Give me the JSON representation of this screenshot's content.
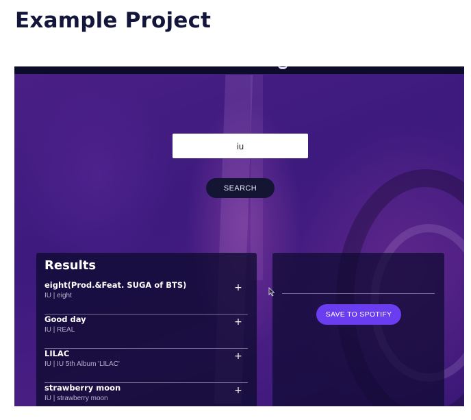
{
  "page": {
    "heading": "Example Project"
  },
  "app": {
    "search": {
      "value": "iu",
      "button_label": "SEARCH"
    },
    "results": {
      "title": "Results",
      "tracks": [
        {
          "name": "eight(Prod.&Feat. SUGA of BTS)",
          "meta": "IU | eight",
          "action": "+"
        },
        {
          "name": "Good day",
          "meta": "IU | REAL",
          "action": "+"
        },
        {
          "name": "LILAC",
          "meta": "IU | IU 5th Album 'LILAC'",
          "action": "+"
        },
        {
          "name": "strawberry moon",
          "meta": "IU | strawberry moon",
          "action": "+"
        }
      ]
    },
    "playlist": {
      "name_value": "",
      "save_label": "SAVE TO SPOTIFY"
    }
  },
  "colors": {
    "accent": "#6b3df0",
    "dark_button": "#141433",
    "heading": "#13163a"
  },
  "icons": {
    "add": "plus-icon",
    "pointer": "mouse-cursor-icon"
  }
}
